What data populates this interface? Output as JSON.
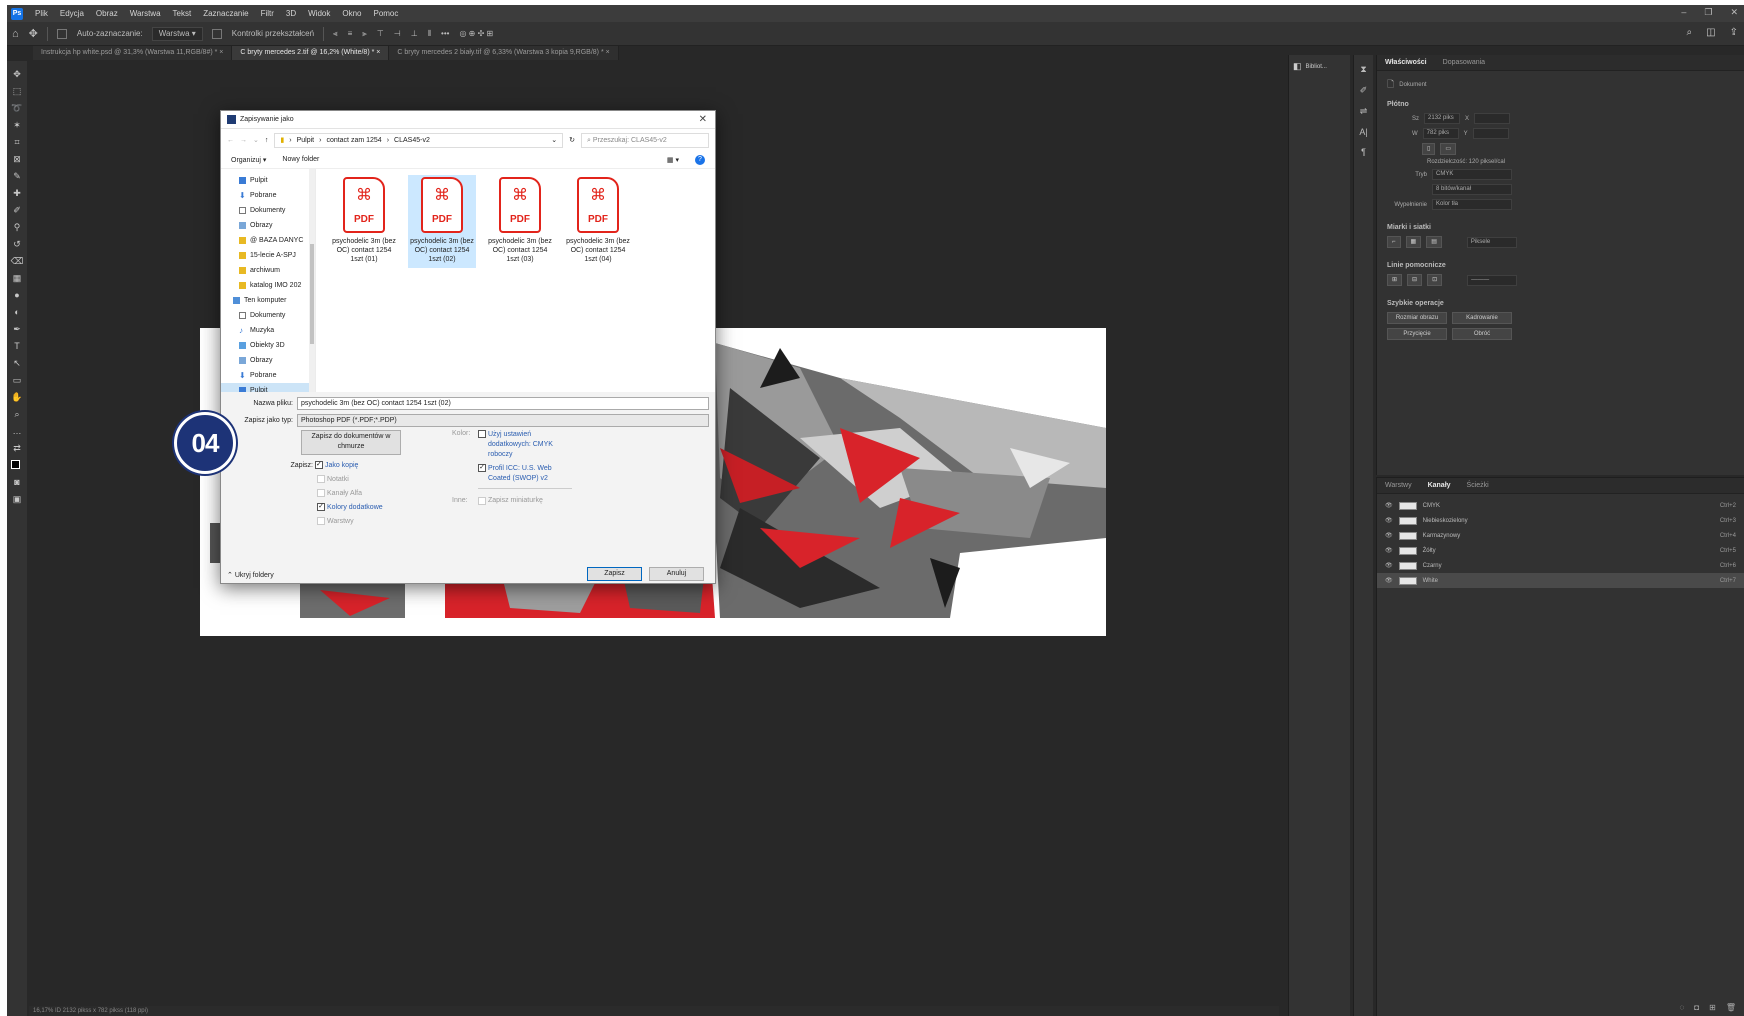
{
  "menu": [
    "Plik",
    "Edycja",
    "Obraz",
    "Warstwa",
    "Tekst",
    "Zaznaczanie",
    "Filtr",
    "3D",
    "Widok",
    "Okno",
    "Pomoc"
  ],
  "options": {
    "auto_select": "Auto-zaznaczanie:",
    "auto_select_value": "Warstwa",
    "transform": "Kontrolki przekształceń"
  },
  "tabs": [
    "Instrukcja hp white.psd @ 31,3% (Warstwa 11,RGB/8#) *",
    "C bryty mercedes 2.tif @ 16,2% (White/8) *",
    "C bryty mercedes 2 biały.tif @ 6,33% (Warstwa 3 kopia 9,RGB/8) *"
  ],
  "status": "16,17%   ID 2132 pikss x 782 pikss (118 ppi)",
  "dialog": {
    "title": "Zapisywanie jako",
    "breadcrumb": [
      "Pulpit",
      "contact zam 1254",
      "CLAS45-v2"
    ],
    "search_placeholder": "Przeszukaj: CLAS45-v2",
    "organize": "Organizuj ▾",
    "new_folder": "Nowy folder",
    "nav": [
      "Pulpit",
      "Pobrane",
      "Dokumenty",
      "Obrazy",
      "@ BAZA DANYC",
      "15-lecie A-SPJ",
      "archiwum",
      "katalog IMO 202",
      "Ten komputer",
      "Dokumenty",
      "Muzyka",
      "Obiekty 3D",
      "Obrazy",
      "Pobrane",
      "Pulpit"
    ],
    "files": [
      {
        "name": "psychodelic 3m (bez OC) contact 1254 1szt (01)"
      },
      {
        "name": "psychodelic 3m (bez OC) contact 1254 1szt (02)"
      },
      {
        "name": "psychodelic 3m (bez OC) contact 1254 1szt (03)"
      },
      {
        "name": "psychodelic 3m (bez OC) contact 1254 1szt (04)"
      }
    ],
    "pdf_label": "PDF",
    "filename_label": "Nazwa pliku:",
    "filename_value": "psychodelic 3m (bez OC) contact 1254 1szt (02)",
    "filetype_label": "Zapisz jako typ:",
    "filetype_value": "Photoshop PDF (*.PDF;*.PDP)",
    "cloud_button": "Zapisz do dokumentów w chmurze",
    "save_label": "Zapisz:",
    "as_copy": "Jako kopię",
    "notes": "Notatki",
    "alpha": "Kanały Alfa",
    "spot": "Kolory dodatkowe",
    "layers": "Warstwy",
    "color_label": "Kolor:",
    "proof": "Użyj ustawień dodatkowych: CMYK roboczy",
    "icc": "Profil ICC: U.S. Web Coated (SWOP) v2",
    "other_label": "Inne:",
    "thumb": "Zapisz miniaturkę",
    "hide_folders": "Ukryj foldery",
    "save_btn": "Zapisz",
    "cancel_btn": "Anuluj"
  },
  "properties": {
    "tabs": [
      "Właściwości",
      "Dopasowania"
    ],
    "doc": "Dokument",
    "canvas": "Płótno",
    "w": "2132 piks",
    "h": "782 piks",
    "x_lbl": "X",
    "y_lbl": "Y",
    "w_lbl": "Sz",
    "h_lbl": "W",
    "res": "Rozdzielczość: 120 piksel/cal",
    "mode_lbl": "Tryb",
    "mode": "CMYK",
    "depth": "8 bitów/kanał",
    "fill_lbl": "Wypełnienie",
    "fill": "Kolor tła",
    "rulers": "Miarki i siatki",
    "unit": "Piksele",
    "guides": "Linie pomocnicze",
    "quick": "Szybkie operacje",
    "q1": "Rozmiar obrazu",
    "q2": "Kadrowanie",
    "q3": "Przycięcie",
    "q4": "Obróć"
  },
  "channels_tabs": [
    "Warstwy",
    "Kanały",
    "Ścieżki"
  ],
  "channels": [
    {
      "name": "CMYK",
      "sc": "Ctrl+2"
    },
    {
      "name": "Niebieskozielony",
      "sc": "Ctrl+3"
    },
    {
      "name": "Karmazynowy",
      "sc": "Ctrl+4"
    },
    {
      "name": "Żółty",
      "sc": "Ctrl+5"
    },
    {
      "name": "Czarny",
      "sc": "Ctrl+6"
    },
    {
      "name": "White",
      "sc": "Ctrl+7"
    }
  ],
  "dock_item": "Bibliot...",
  "step_badge": "04",
  "colors": {
    "accent": "#e2241b",
    "badge": "#1d3377",
    "select": "#cce8ff"
  }
}
